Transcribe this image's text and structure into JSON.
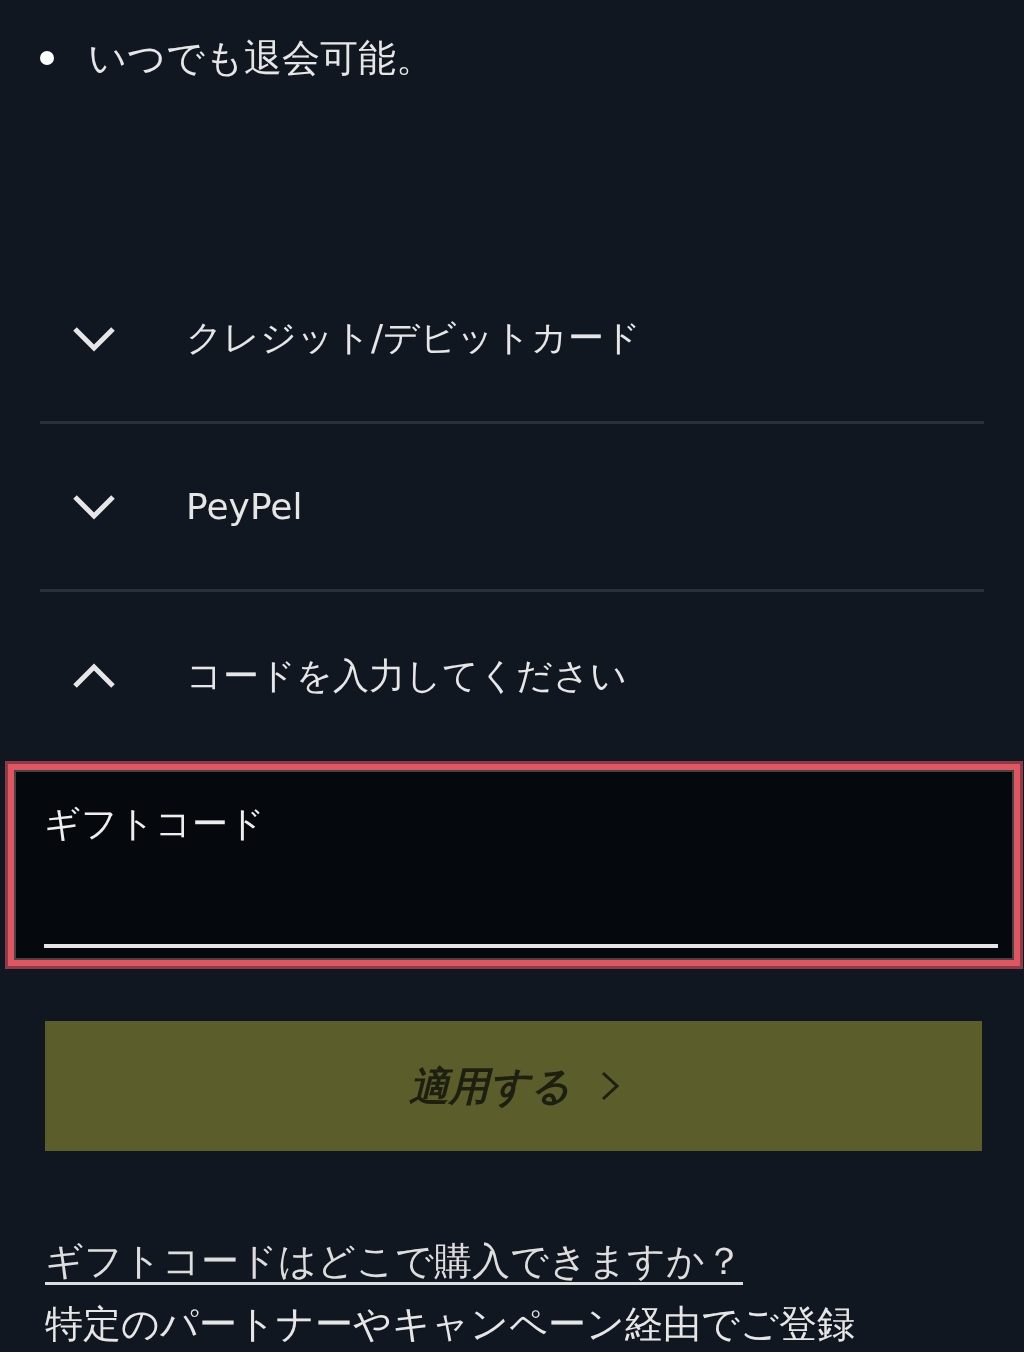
{
  "bullets": [
    "いつでも退会可能。"
  ],
  "payment_methods": [
    {
      "label": "クレジット/デビットカード",
      "expanded": false
    },
    {
      "label": "PeyPel",
      "expanded": false
    },
    {
      "label": "コードを入力してください",
      "expanded": true
    }
  ],
  "gift_code_field": {
    "label": "ギフトコード",
    "highlighted": true
  },
  "apply_button": {
    "label": "適用する",
    "disabled": true
  },
  "help_link": "ギフトコードはどこで購入できますか？",
  "note": "特定のパートナーやキャンペーン経由でご登録"
}
